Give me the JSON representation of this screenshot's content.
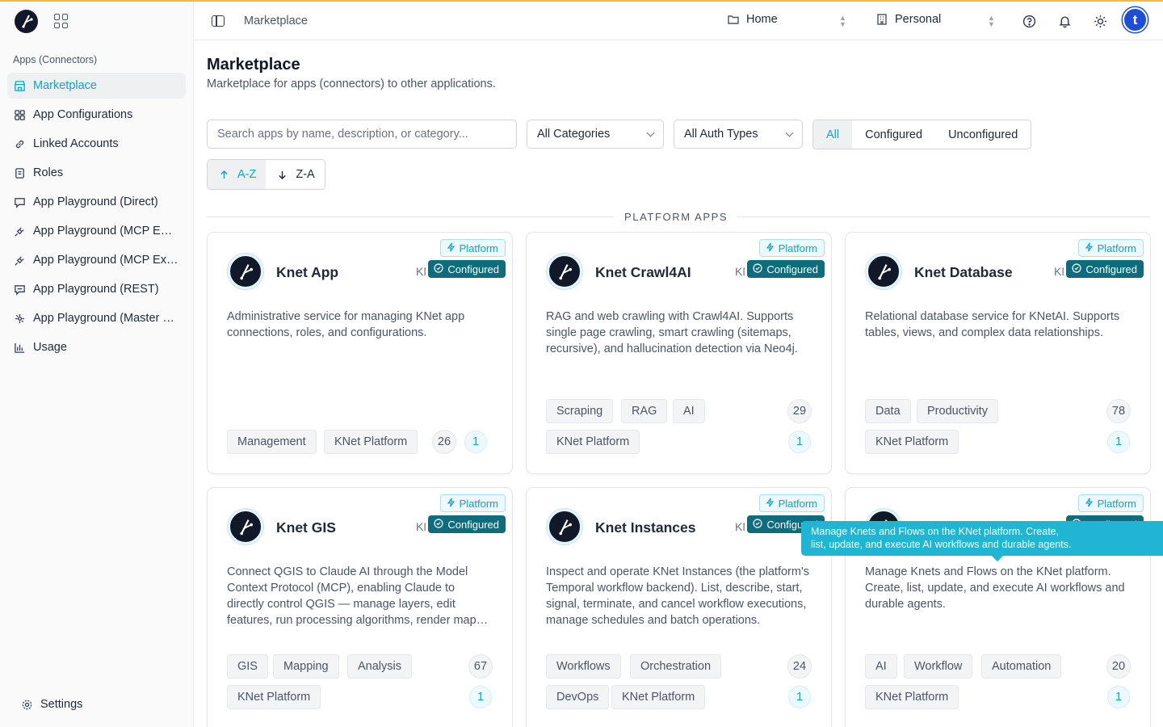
{
  "colors": {
    "accent": "#0ea5c6",
    "configured_badge": "#0f6b7e",
    "tooltip": "#1fb5d3"
  },
  "sidebar": {
    "section_label": "Apps (Connectors)",
    "items": [
      {
        "label": "Marketplace",
        "icon": "store-icon",
        "active": true
      },
      {
        "label": "App Configurations",
        "icon": "grid-icon"
      },
      {
        "label": "Linked Accounts",
        "icon": "link-icon"
      },
      {
        "label": "Roles",
        "icon": "roles-icon"
      },
      {
        "label": "App Playground (Direct)",
        "icon": "chat-icon"
      },
      {
        "label": "App Playground (MCP Embedded)",
        "icon": "plug-icon"
      },
      {
        "label": "App Playground (MCP External)",
        "icon": "plug-icon"
      },
      {
        "label": "App Playground (REST)",
        "icon": "chat-icon"
      },
      {
        "label": "App Playground (Master LLM)",
        "icon": "sparkle-icon"
      },
      {
        "label": "Usage",
        "icon": "bar-chart-icon"
      }
    ],
    "settings_label": "Settings"
  },
  "header": {
    "breadcrumb": "Marketplace",
    "workspace": "Home",
    "account": "Personal",
    "avatar_letter": "t"
  },
  "page": {
    "title": "Marketplace",
    "subtitle": "Marketplace for apps (connectors) to other applications."
  },
  "filters": {
    "search_placeholder": "Search apps by name, description, or category...",
    "categories": "All Categories",
    "auth_types": "All Auth Types",
    "segments": [
      "All",
      "Configured",
      "Unconfigured"
    ],
    "sort_az": "A-Z",
    "sort_za": "Z-A"
  },
  "section_label": "PLATFORM APPS",
  "badges": {
    "platform": "Platform",
    "configured": "Configured"
  },
  "cards": [
    {
      "name": "Knet App",
      "clipped": "KN",
      "desc": "Administrative service for managing KNet app connections, roles, and configurations.",
      "tags_row1": [
        "Management",
        "KNet Platform"
      ],
      "tags_row2": [],
      "count": "26",
      "configs": "1"
    },
    {
      "name": "Knet Crawl4AI",
      "clipped": "KN",
      "desc": "RAG and web crawling with Crawl4AI. Supports single page crawling, smart crawling (sitemaps, recursive), and hallucination detection via Neo4j.",
      "tags_row1": [
        "Scraping",
        "RAG",
        "AI"
      ],
      "tags_row2": [
        "KNet Platform"
      ],
      "count": "29",
      "configs": "1"
    },
    {
      "name": "Knet Database",
      "clipped": "KN",
      "desc": "Relational database service for KNetAI. Supports tables, views, and complex data relationships.",
      "tags_row1": [
        "Data",
        "Productivity"
      ],
      "tags_row2": [
        "KNet Platform"
      ],
      "count": "78",
      "configs": "1"
    },
    {
      "name": "Knet GIS",
      "clipped": "KN",
      "desc": "Connect QGIS to Claude AI through the Model Context Protocol (MCP), enabling Claude to directly control QGIS — manage layers, edit features, run processing algorithms, render maps, and more.",
      "tags_row1": [
        "GIS",
        "Mapping",
        "Analysis"
      ],
      "tags_row2": [
        "KNet Platform"
      ],
      "count": "67",
      "configs": "1"
    },
    {
      "name": "Knet Instances",
      "clipped": "KN",
      "desc": "Inspect and operate KNet Instances (the platform's Temporal workflow backend). List, describe, start, signal, terminate, and cancel workflow executions, manage schedules and batch operations.",
      "tags_row1": [
        "Workflows",
        "Orchestration"
      ],
      "tags_row2": [
        "DevOps",
        "KNet Platform"
      ],
      "count": "24",
      "configs": "1"
    },
    {
      "name": "",
      "clipped": "",
      "desc": "Manage Knets and Flows on the KNet platform. Create, list, update, and execute AI workflows and durable agents.",
      "tags_row1": [
        "AI",
        "Workflow",
        "Automation"
      ],
      "tags_row2": [
        "KNet Platform"
      ],
      "count": "20",
      "configs": "1"
    }
  ],
  "tooltip": {
    "line1": "Manage Knets and Flows on the KNet platform. Create,",
    "line2": "list, update, and execute AI workflows and durable agents."
  }
}
